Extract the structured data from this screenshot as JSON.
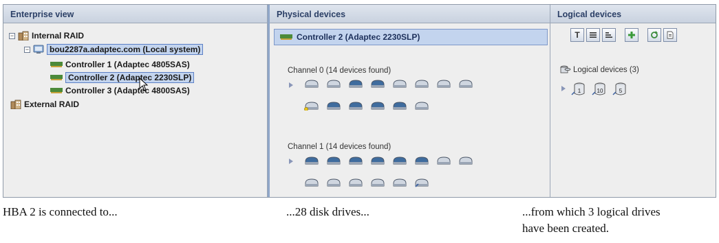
{
  "enterprise": {
    "header": "Enterprise view",
    "internal_raid": "Internal RAID",
    "system": "bou2287a.adaptec.com (Local system)",
    "controllers": [
      "Controller 1 (Adaptec 4805SAS)",
      "Controller 2 (Adaptec 2230SLP)",
      "Controller 3 (Adaptec 4800SAS)"
    ],
    "external_raid": "External RAID"
  },
  "physical": {
    "header": "Physical devices",
    "selected_controller": "Controller 2 (Adaptec 2230SLP)",
    "channels": [
      {
        "title": "Channel 0  (14 devices found)"
      },
      {
        "title": "Channel 1  (14 devices found)"
      }
    ]
  },
  "logical": {
    "header": "Logical devices",
    "toolbar_text_button": "T",
    "group_label": "Logical devices (3)",
    "raid_levels": [
      "1",
      "10",
      "5"
    ]
  },
  "captions": {
    "left": "HBA 2 is connected to...",
    "middle": "...28 disk drives...",
    "right_line1": "...from which 3 logical drives",
    "right_line2": "have been created."
  },
  "colors": {
    "selection": "#c3d4ee",
    "header_text": "#2b3f66",
    "disk_gray": "#cfd6e0",
    "disk_blue": "#3f6c9e",
    "disk_hotspare": "#e8c51d"
  }
}
